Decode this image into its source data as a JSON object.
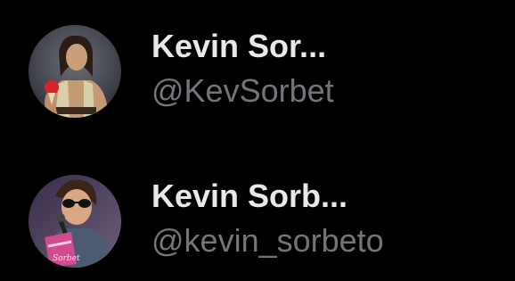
{
  "accounts": [
    {
      "display_name": "Kevin Sor...",
      "handle": "@KevSorbet",
      "avatar_icon": "shirtless-man-holding-cone-avatar"
    },
    {
      "display_name": "Kevin Sorb...",
      "handle": "@kevin_sorbeto",
      "avatar_icon": "man-with-sunglasses-holding-sorbet-box-avatar"
    }
  ],
  "colors": {
    "background": "#000000",
    "name_text": "#e7e9ea",
    "handle_text": "#71767b"
  }
}
